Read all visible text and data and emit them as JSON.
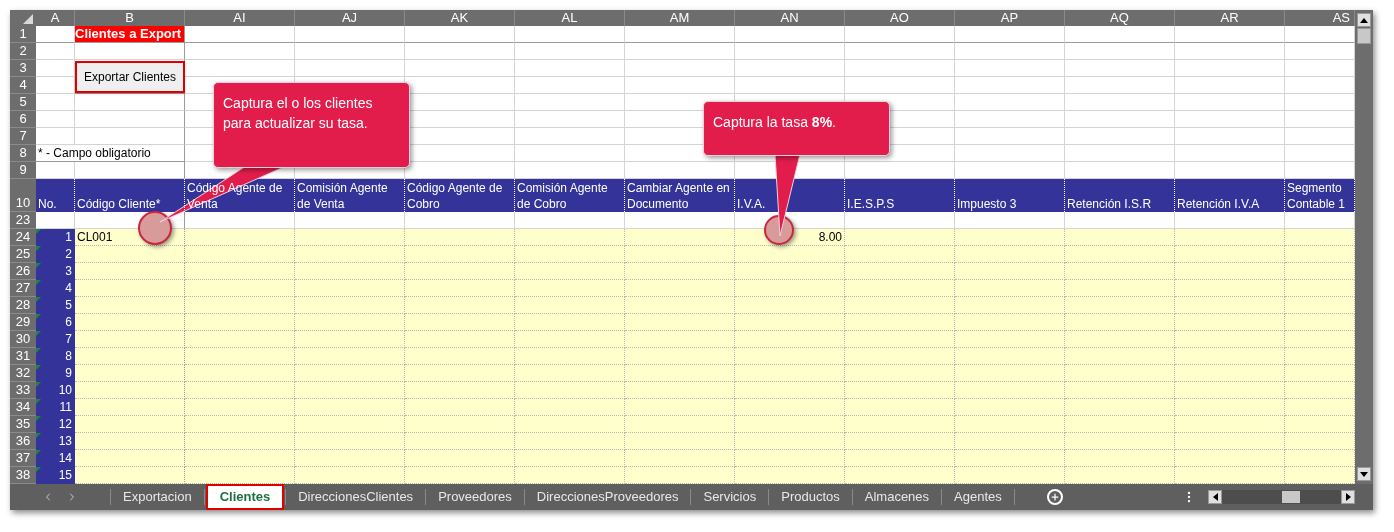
{
  "columns": [
    "A",
    "B",
    "AI",
    "AJ",
    "AK",
    "AL",
    "AM",
    "AN",
    "AO",
    "AP",
    "AQ",
    "AR",
    "AS"
  ],
  "table": {
    "columns": [
      "No.",
      "Código Cliente*",
      "Código Agente de Venta",
      "Comisión Agente de Venta",
      "Código Agente de Cobro",
      "Comisión Agente de Cobro",
      "Cambiar Agente en Documento",
      "I.V.A.",
      "I.E.S.P.S",
      "Impuesto 3",
      "Retención I.S.R",
      "Retención I.V.A",
      "Segmento Contable 1"
    ]
  },
  "rows": [
    {
      "number": "1",
      "kind": "title",
      "text": "Clientes a Export"
    },
    {
      "number": "2",
      "kind": "blank"
    },
    {
      "number": "3",
      "kind": "button",
      "text": "Exportar Clientes"
    },
    {
      "number": "4",
      "kind": "under_button"
    },
    {
      "number": "5",
      "kind": "blank"
    },
    {
      "number": "6",
      "kind": "blank"
    },
    {
      "number": "7",
      "kind": "blank"
    },
    {
      "number": "8",
      "kind": "note",
      "text": "* - Campo obligatorio"
    },
    {
      "number": "9",
      "kind": "blank"
    },
    {
      "number": "10",
      "kind": "header"
    },
    {
      "number": "23",
      "kind": "blank"
    },
    {
      "number": "24",
      "kind": "data",
      "no": "1",
      "code": "CL001",
      "iva": "8.00"
    },
    {
      "number": "25",
      "kind": "data",
      "no": "2"
    },
    {
      "number": "26",
      "kind": "data",
      "no": "3"
    },
    {
      "number": "27",
      "kind": "data",
      "no": "4"
    },
    {
      "number": "28",
      "kind": "data",
      "no": "5"
    },
    {
      "number": "29",
      "kind": "data",
      "no": "6"
    },
    {
      "number": "30",
      "kind": "data",
      "no": "7"
    },
    {
      "number": "31",
      "kind": "data",
      "no": "8"
    },
    {
      "number": "32",
      "kind": "data",
      "no": "9"
    },
    {
      "number": "33",
      "kind": "data",
      "no": "10"
    },
    {
      "number": "34",
      "kind": "data",
      "no": "11"
    },
    {
      "number": "35",
      "kind": "data",
      "no": "12"
    },
    {
      "number": "36",
      "kind": "data",
      "no": "13"
    },
    {
      "number": "37",
      "kind": "data",
      "no": "14"
    },
    {
      "number": "38",
      "kind": "data",
      "no": "15"
    }
  ],
  "callouts": [
    {
      "text": "Captura el o los clientes para actualizar su tasa."
    },
    {
      "text": "Captura la tasa **8%**."
    }
  ],
  "sheet_tabs": [
    {
      "label": "Exportacion",
      "selected": false
    },
    {
      "label": "Clientes",
      "selected": true
    },
    {
      "label": "DireccionesClientes",
      "selected": false
    },
    {
      "label": "Proveedores",
      "selected": false
    },
    {
      "label": "DireccionesProveedores",
      "selected": false
    },
    {
      "label": "Servicios",
      "selected": false
    },
    {
      "label": "Productos",
      "selected": false
    },
    {
      "label": "Almacenes",
      "selected": false
    },
    {
      "label": "Agentes",
      "selected": false
    }
  ]
}
